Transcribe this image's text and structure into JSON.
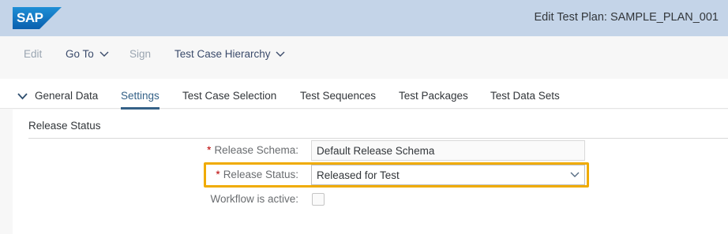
{
  "shell": {
    "logo_text": "SAP",
    "title": "Edit Test Plan: SAMPLE_PLAN_001"
  },
  "toolbar": {
    "edit_label": "Edit",
    "goto_label": "Go To",
    "sign_label": "Sign",
    "hierarchy_label": "Test Case Hierarchy"
  },
  "tabs": [
    {
      "label": "General Data"
    },
    {
      "label": "Settings"
    },
    {
      "label": "Test Case Selection"
    },
    {
      "label": "Test Sequences"
    },
    {
      "label": "Test Packages"
    },
    {
      "label": "Test Data Sets"
    }
  ],
  "section": {
    "title": "Release Status",
    "release_schema_label": "Release Schema:",
    "release_schema_value": "Default Release Schema",
    "release_status_label": "Release Status:",
    "release_status_value": "Released for Test",
    "workflow_label": "Workflow is active:",
    "workflow_checked": false
  },
  "colors": {
    "shell_bg": "#c4d4e8",
    "accent": "#346187",
    "highlight": "#f0ab00",
    "required": "#bb0000"
  }
}
